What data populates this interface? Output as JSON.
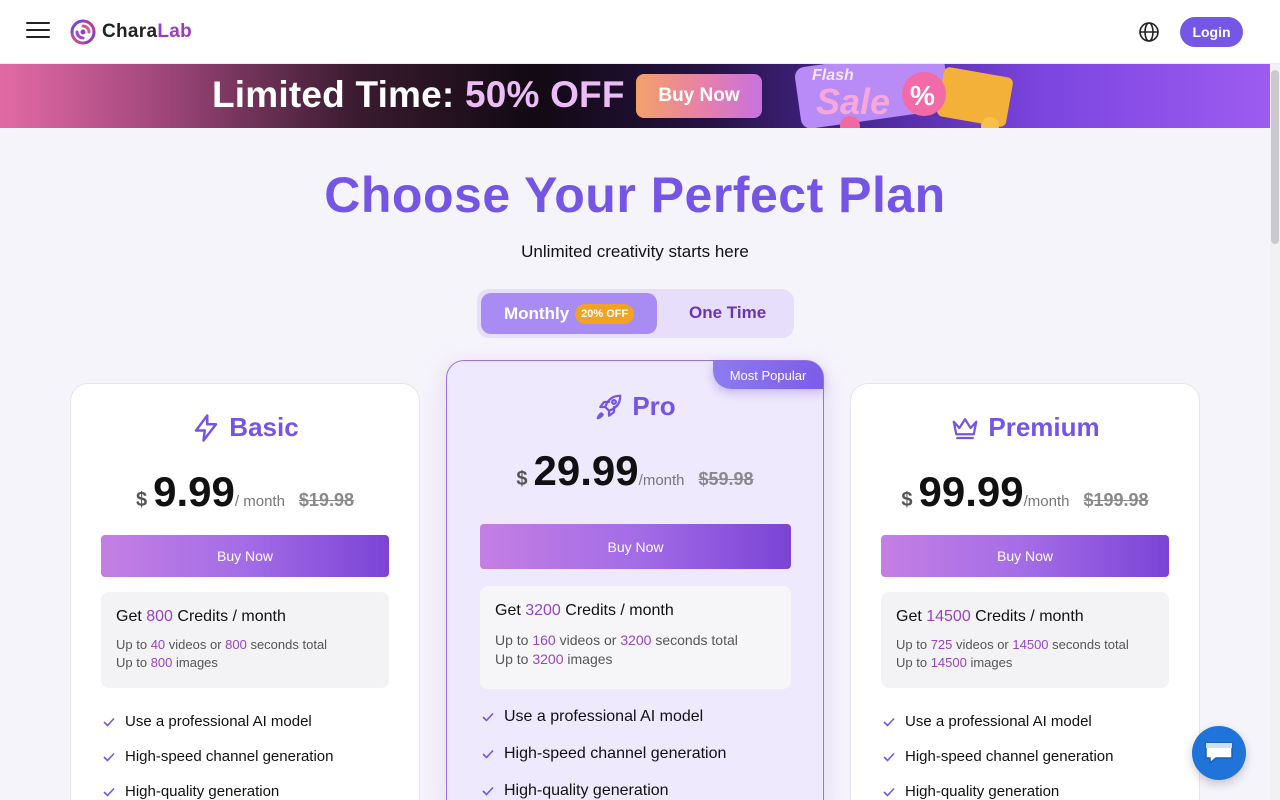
{
  "header": {
    "brand_part1": "Chara",
    "brand_part2": "Lab",
    "login_label": "Login",
    "menu_icon": "hamburger-icon",
    "language_icon": "globe-icon"
  },
  "banner": {
    "text_start": "Limited Time: ",
    "text_off": "50% OFF",
    "button_label": "Buy Now",
    "art_text_1": "Flash",
    "art_text_2": "Sale",
    "art_text_3": "%"
  },
  "hero": {
    "title": "Choose Your Perfect Plan",
    "subtitle": "Unlimited creativity starts here"
  },
  "billing_toggle": {
    "monthly_label": "Monthly",
    "monthly_badge": "20% OFF",
    "one_time_label": "One Time",
    "selected": "Monthly"
  },
  "ribbon": "Most Popular",
  "plans": [
    {
      "name": "Basic",
      "icon": "lightning-icon",
      "currency": "$",
      "price": "9.99",
      "period": "/ month",
      "original_price": "$19.98",
      "button_label": "Buy Now",
      "credits_prefix": "Get ",
      "credits_value": "800",
      "credits_suffix": " Credits / month",
      "videos_prefix": "Up to ",
      "videos_value": "40",
      "videos_mid": " videos or ",
      "seconds_value": "800",
      "seconds_suffix": " seconds total",
      "images_prefix": "Up to ",
      "images_value": "800",
      "images_suffix": " images",
      "features": [
        "Use a professional AI model",
        "High-speed channel generation",
        "High-quality generation"
      ]
    },
    {
      "name": "Pro",
      "icon": "rocket-icon",
      "currency": "$",
      "price": "29.99",
      "period": "/month",
      "original_price": "$59.98",
      "button_label": "Buy Now",
      "credits_prefix": "Get ",
      "credits_value": "3200",
      "credits_suffix": " Credits / month",
      "videos_prefix": "Up to ",
      "videos_value": "160",
      "videos_mid": " videos or ",
      "seconds_value": "3200",
      "seconds_suffix": " seconds total",
      "images_prefix": "Up to ",
      "images_value": "3200",
      "images_suffix": " images",
      "features": [
        "Use a professional AI model",
        "High-speed channel generation",
        "High-quality generation"
      ]
    },
    {
      "name": "Premium",
      "icon": "crown-icon",
      "currency": "$",
      "price": "99.99",
      "period": "/month",
      "original_price": "$199.98",
      "button_label": "Buy Now",
      "credits_prefix": "Get ",
      "credits_value": "14500",
      "credits_suffix": " Credits / month",
      "videos_prefix": "Up to ",
      "videos_value": "725",
      "videos_mid": " videos or ",
      "seconds_value": "14500",
      "seconds_suffix": " seconds total",
      "images_prefix": "Up to ",
      "images_value": "14500",
      "images_suffix": " images",
      "features": [
        "Use a professional AI model",
        "High-speed channel generation",
        "High-quality generation"
      ]
    }
  ],
  "chat_icon": "chat-icon",
  "colors": {
    "accent": "#7555e6",
    "highlight": "#9545c0",
    "badge": "#f2a323",
    "chat": "#1f73d9"
  }
}
